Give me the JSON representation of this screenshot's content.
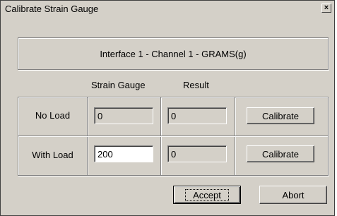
{
  "window": {
    "title": "Calibrate Strain Gauge",
    "close_glyph": "×"
  },
  "header": {
    "text": "Interface 1 - Channel 1 - GRAMS(g)"
  },
  "columns": {
    "strain_gauge": "Strain Gauge",
    "result": "Result"
  },
  "rows": [
    {
      "label": "No Load",
      "strain_gauge": "0",
      "result": "0",
      "button": "Calibrate"
    },
    {
      "label": "With Load",
      "strain_gauge": "200",
      "result": "0",
      "button": "Calibrate"
    }
  ],
  "footer": {
    "accept": "Accept",
    "abort": "Abort"
  }
}
